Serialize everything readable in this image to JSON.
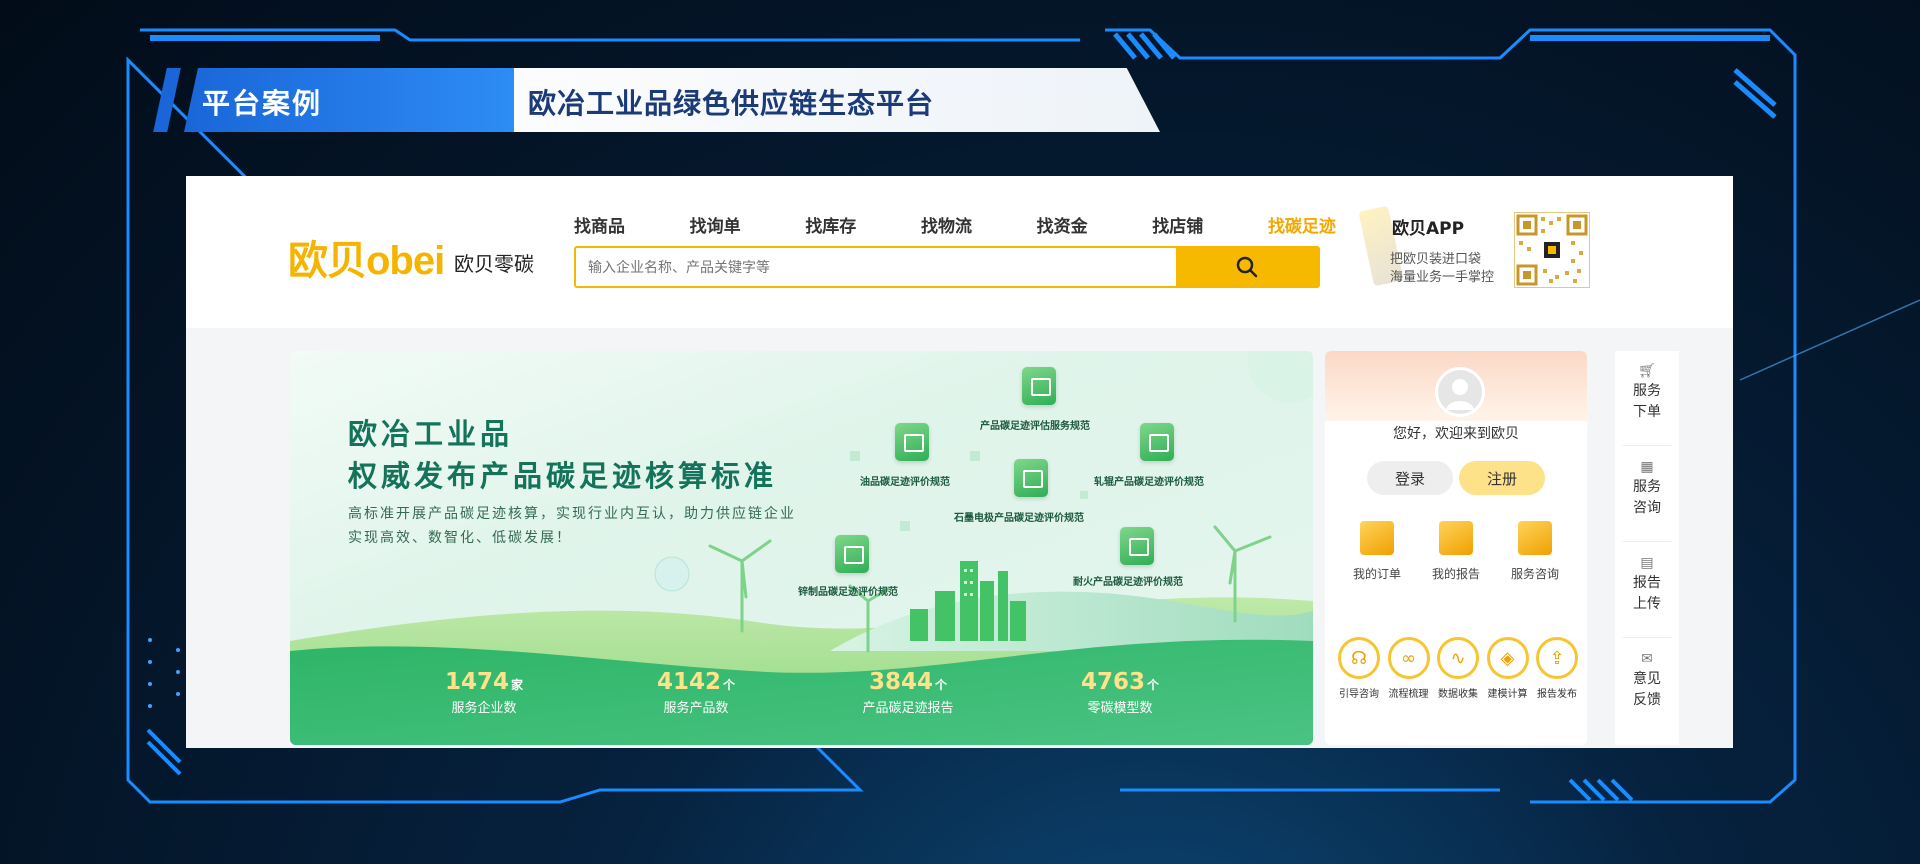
{
  "header": {
    "tag": "平台案例",
    "title": "欧冶工业品绿色供应链生态平台"
  },
  "site": {
    "logo_text": "欧贝obei",
    "logo_sub": "欧贝零碳",
    "nav": [
      "找商品",
      "找询单",
      "找库存",
      "找物流",
      "找资金",
      "找店铺",
      "找碳足迹"
    ],
    "active_nav": "找碳足迹",
    "search_placeholder": "输入企业名称、产品关键字等",
    "app": {
      "title": "欧贝APP",
      "line1": "把欧贝装进口袋",
      "line2": "海量业务一手掌控"
    }
  },
  "banner": {
    "headline1": "欧冶工业品",
    "headline2": "权威发布产品碳足迹核算标准",
    "desc1": "高标准开展产品碳足迹核算，实现行业内互认，助力供应链企业",
    "desc2": "实现高效、数智化、低碳发展！",
    "standards": [
      "产品碳足迹评估服务规范",
      "油品碳足迹评价规范",
      "轧辊产品碳足迹评价规范",
      "石墨电极产品碳足迹评价规范",
      "锌制品碳足迹评价规范",
      "耐火产品碳足迹评价规范"
    ],
    "stats": [
      {
        "value": "1474",
        "unit": "家",
        "label": "服务企业数"
      },
      {
        "value": "4142",
        "unit": "个",
        "label": "服务产品数"
      },
      {
        "value": "3844",
        "unit": "个",
        "label": "产品碳足迹报告"
      },
      {
        "value": "4763",
        "unit": "个",
        "label": "零碳模型数"
      }
    ]
  },
  "user_panel": {
    "greeting": "您好，欢迎来到欧贝",
    "login": "登录",
    "register": "注册",
    "quick": [
      "我的订单",
      "我的报告",
      "服务咨询"
    ],
    "flow": [
      "引导咨询",
      "流程梳理",
      "数据收集",
      "建模计算",
      "报告发布"
    ]
  },
  "rail": [
    {
      "line1": "服务",
      "line2": "下单"
    },
    {
      "line1": "服务",
      "line2": "咨询"
    },
    {
      "line1": "报告",
      "line2": "上传"
    },
    {
      "line1": "意见",
      "line2": "反馈"
    }
  ],
  "colors": {
    "accent_yellow": "#f7b900",
    "banner_green": "#14735a",
    "hud_blue": "#1a8cff"
  }
}
